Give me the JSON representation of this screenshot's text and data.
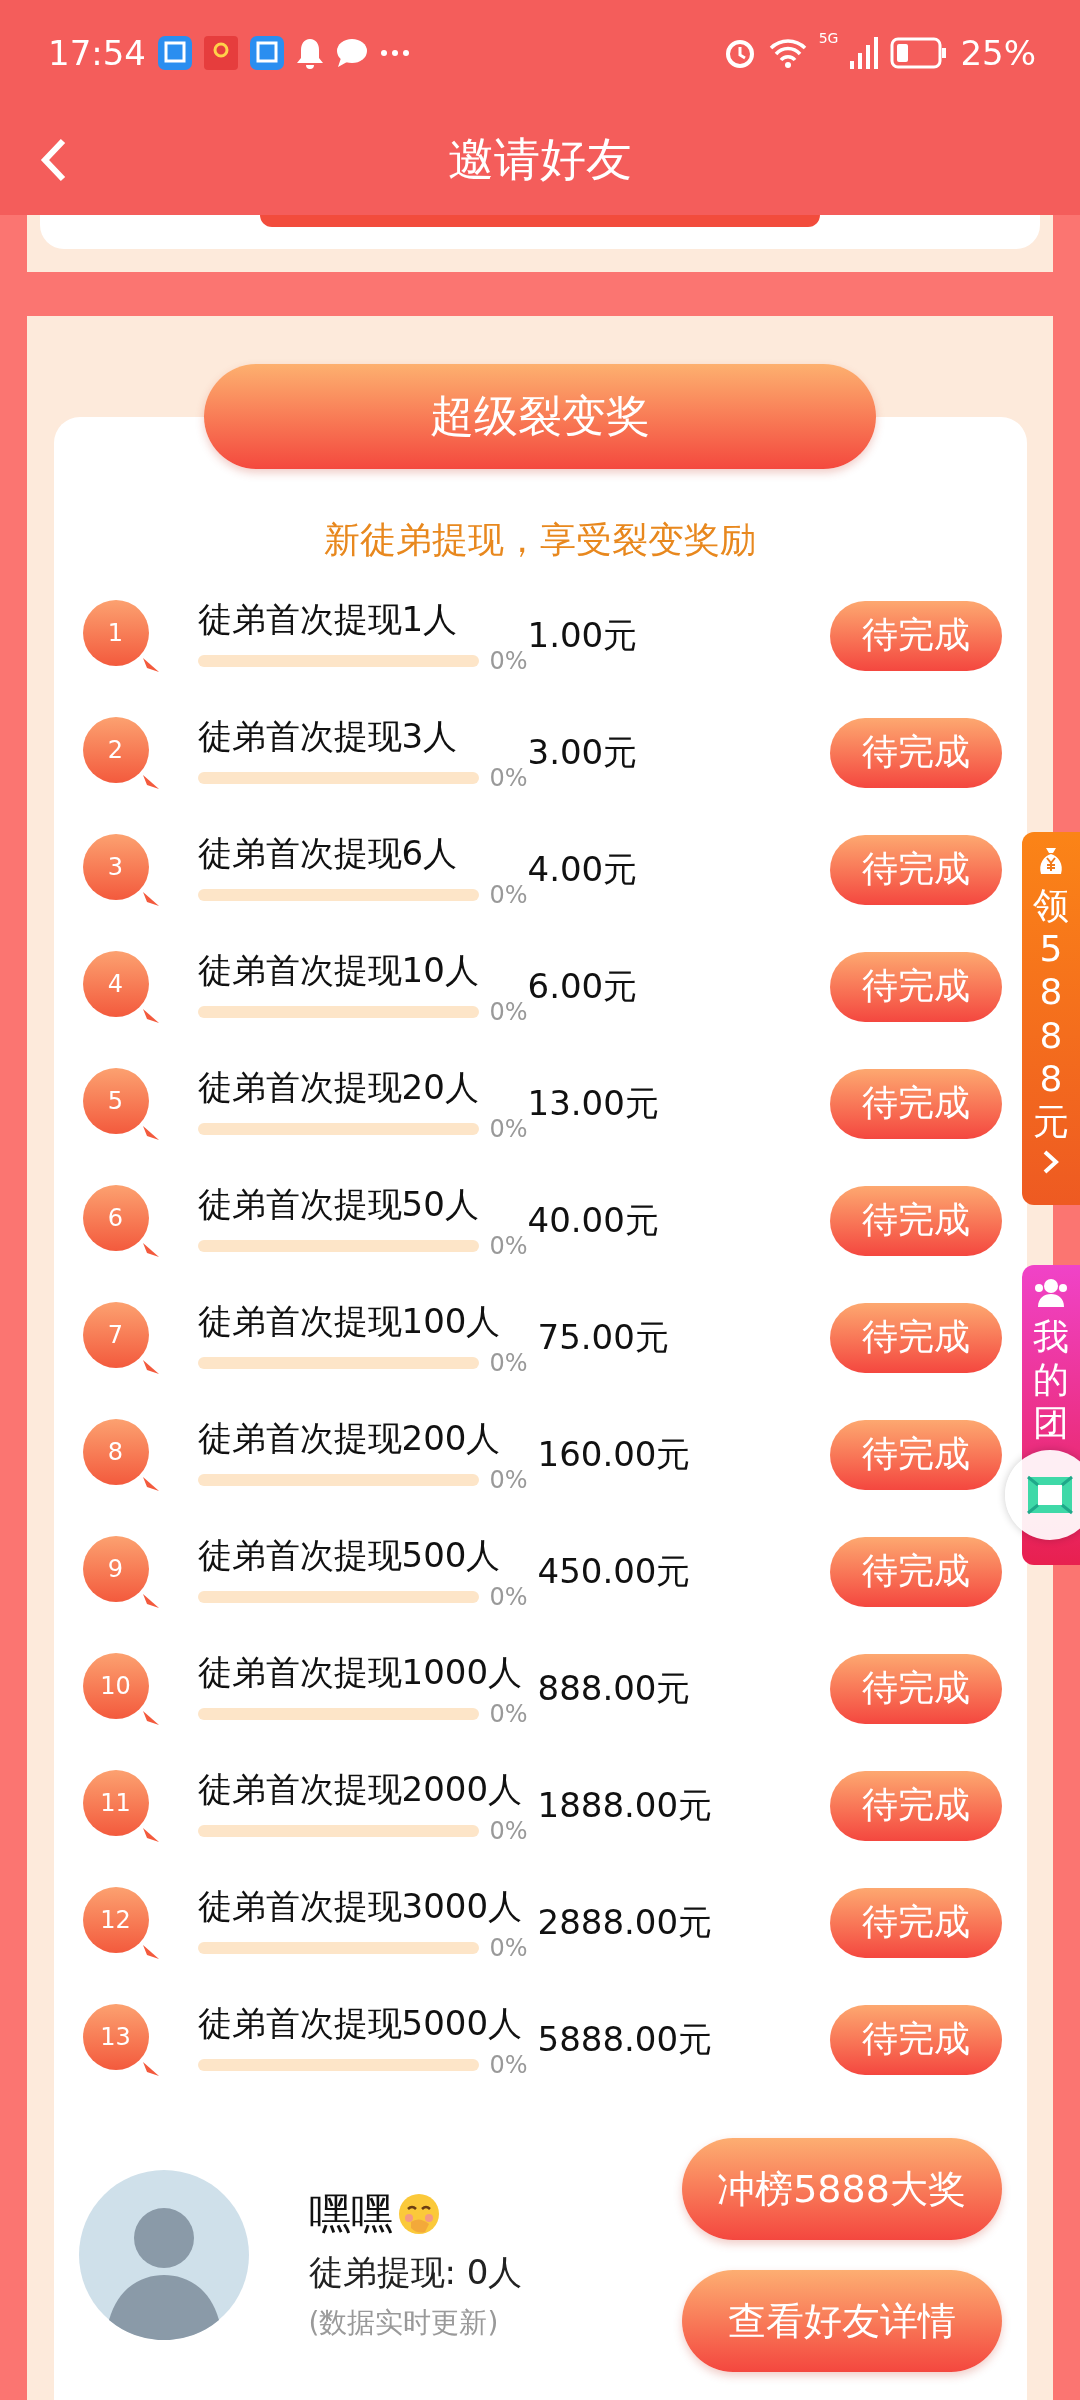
{
  "status_bar": {
    "time": "17:54",
    "network": "5G",
    "battery": "25%"
  },
  "header": {
    "title": "邀请好友"
  },
  "section": {
    "title": "超级裂变奖",
    "subtitle": "新徒弟提现，享受裂变奖励",
    "tasks": [
      {
        "rank": "1",
        "name": "徒弟首次提现1人",
        "percent": "0%",
        "reward": "1.00元",
        "button": "待完成"
      },
      {
        "rank": "2",
        "name": "徒弟首次提现3人",
        "percent": "0%",
        "reward": "3.00元",
        "button": "待完成"
      },
      {
        "rank": "3",
        "name": "徒弟首次提现6人",
        "percent": "0%",
        "reward": "4.00元",
        "button": "待完成"
      },
      {
        "rank": "4",
        "name": "徒弟首次提现10人",
        "percent": "0%",
        "reward": "6.00元",
        "button": "待完成"
      },
      {
        "rank": "5",
        "name": "徒弟首次提现20人",
        "percent": "0%",
        "reward": "13.00元",
        "button": "待完成"
      },
      {
        "rank": "6",
        "name": "徒弟首次提现50人",
        "percent": "0%",
        "reward": "40.00元",
        "button": "待完成"
      },
      {
        "rank": "7",
        "name": "徒弟首次提现100人",
        "percent": "0%",
        "reward": "75.00元",
        "button": "待完成"
      },
      {
        "rank": "8",
        "name": "徒弟首次提现200人",
        "percent": "0%",
        "reward": "160.00元",
        "button": "待完成"
      },
      {
        "rank": "9",
        "name": "徒弟首次提现500人",
        "percent": "0%",
        "reward": "450.00元",
        "button": "待完成"
      },
      {
        "rank": "10",
        "name": "徒弟首次提现1000人",
        "percent": "0%",
        "reward": "888.00元",
        "button": "待完成"
      },
      {
        "rank": "11",
        "name": "徒弟首次提现2000人",
        "percent": "0%",
        "reward": "1888.00元",
        "button": "待完成"
      },
      {
        "rank": "12",
        "name": "徒弟首次提现3000人",
        "percent": "0%",
        "reward": "2888.00元",
        "button": "待完成"
      },
      {
        "rank": "13",
        "name": "徒弟首次提现5000人",
        "percent": "0%",
        "reward": "5888.00元",
        "button": "待完成"
      }
    ]
  },
  "profile": {
    "name": "嘿嘿",
    "stat": "徒弟提现: 0人",
    "note": "(数据实时更新)"
  },
  "buttons": [
    {
      "label": "冲榜5888大奖"
    },
    {
      "label": "查看好友详情"
    }
  ],
  "side_tabs": [
    {
      "kind": "reward",
      "text": "领5888元"
    },
    {
      "kind": "team",
      "text": "我的团"
    }
  ]
}
